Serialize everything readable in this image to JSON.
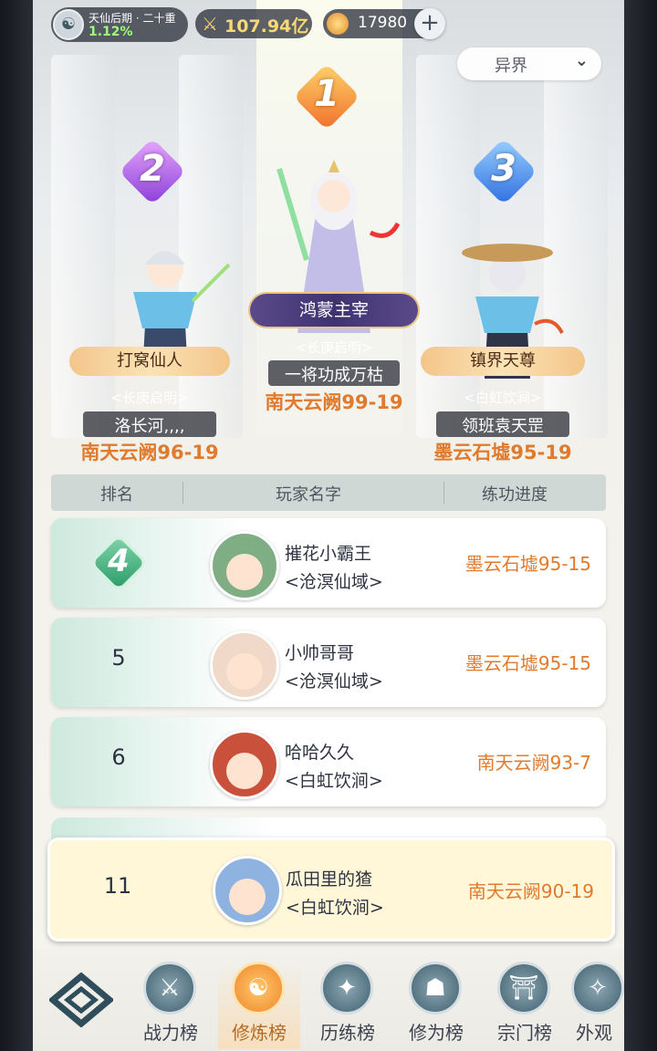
{
  "topbar": {
    "realm_name": "天仙后期 · 二十重",
    "realm_percent": "1.12%",
    "power_value": "107.94亿",
    "coin_value": "17980",
    "plus_symbol": "+"
  },
  "world_selector": {
    "label": "异界",
    "chevron": "⌄"
  },
  "podium": [
    {
      "rank": "1",
      "title": "鸿蒙主宰",
      "sect": "<长庚启明>",
      "name": "一将功成万枯",
      "progress": "南天云阙99-19"
    },
    {
      "rank": "2",
      "title": "打窝仙人",
      "sect": "<长庚启明>",
      "name": "洛长河,,,,",
      "progress": "南天云阙96-19"
    },
    {
      "rank": "3",
      "title": "镇界天尊",
      "sect": "<白虹饮涧>",
      "name": "领班袁天罡",
      "progress": "墨云石墟95-19"
    }
  ],
  "table_header": {
    "rank": "排名",
    "player": "玩家名字",
    "progress": "练功进度"
  },
  "rows": [
    {
      "rank": "4",
      "name": "摧花小霸王",
      "sect": "<沧溟仙域>",
      "progress": "墨云石墟95-15"
    },
    {
      "rank": "5",
      "name": "小帅哥哥",
      "sect": "<沧溟仙域>",
      "progress": "墨云石墟95-15"
    },
    {
      "rank": "6",
      "name": "哈哈久久",
      "sect": "<白虹饮涧>",
      "progress": "南天云阙93-7"
    }
  ],
  "self_row": {
    "rank": "11",
    "name": "瓜田里的猹",
    "sect": "<白虹饮涧>",
    "progress": "南天云阙90-19"
  },
  "bottom_nav": [
    {
      "label": "战力榜",
      "icon": "crossed-swords-icon"
    },
    {
      "label": "修炼榜",
      "icon": "yin-yang-icon",
      "active": true
    },
    {
      "label": "历练榜",
      "icon": "compass-star-icon"
    },
    {
      "label": "修为榜",
      "icon": "sage-hat-icon"
    },
    {
      "label": "宗门榜",
      "icon": "gate-icon"
    },
    {
      "label": "外观",
      "icon": "robe-icon"
    }
  ],
  "colors": {
    "progress": "#e07a2c",
    "active_tab": "#f0862c",
    "rank_green": "#2d9c6a"
  }
}
